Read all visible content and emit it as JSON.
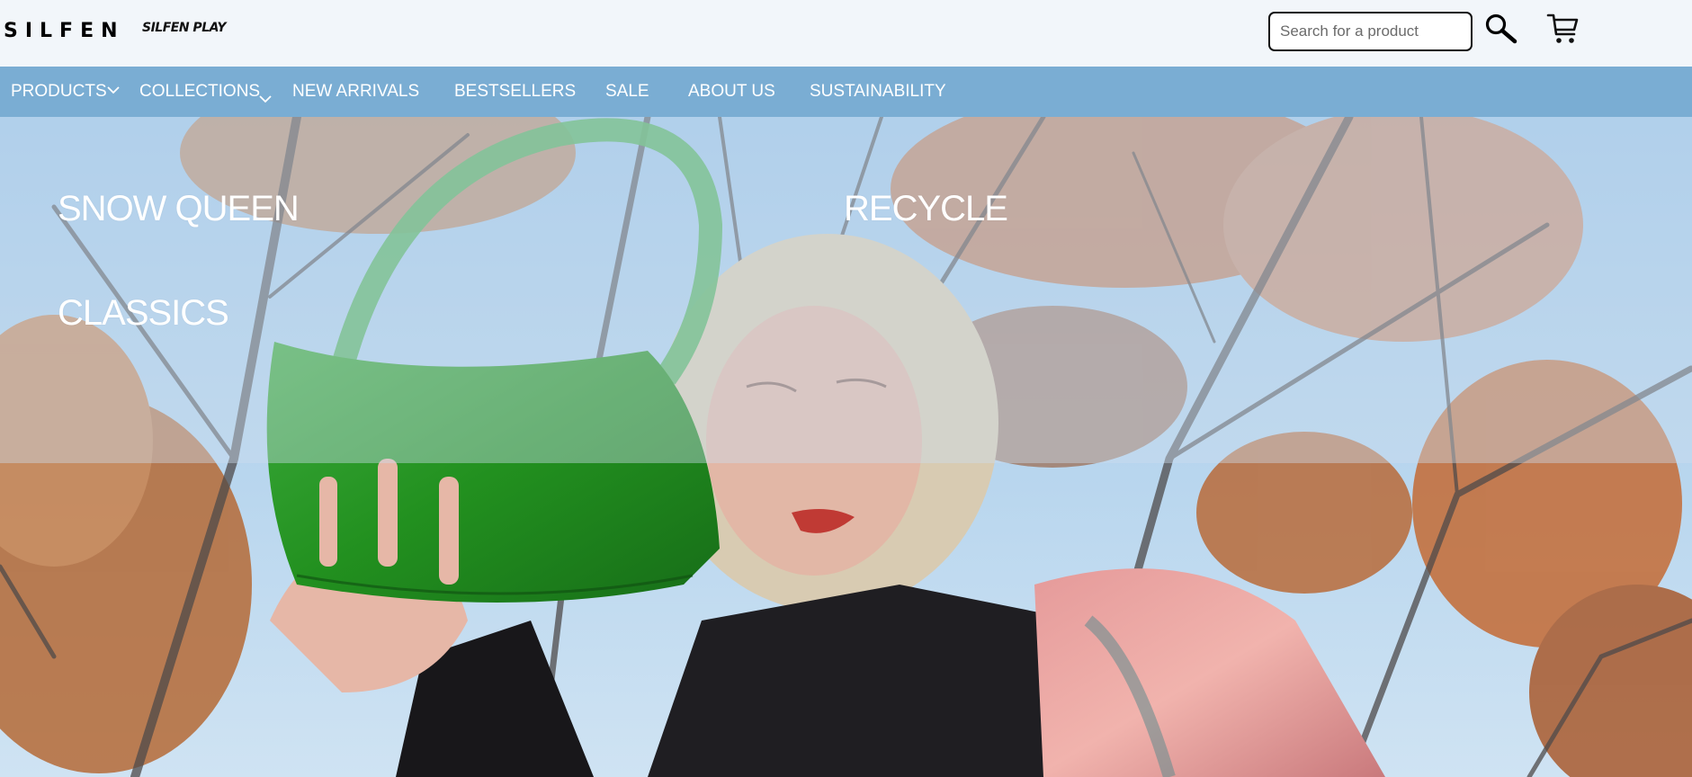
{
  "header": {
    "logo": "SILFEN",
    "sub_logo": "SILFEN PLAY",
    "search_placeholder": "Search for a product"
  },
  "nav": {
    "items": [
      {
        "label": "PRODUCTS",
        "has_dropdown": true
      },
      {
        "label": "COLLECTIONS",
        "has_dropdown": true
      },
      {
        "label": "NEW ARRIVALS"
      },
      {
        "label": "BESTSELLERS"
      },
      {
        "label": "SALE"
      },
      {
        "label": "ABOUT US"
      },
      {
        "label": "SUSTAINABILITY"
      }
    ]
  },
  "collections_menu": {
    "items": [
      "SNOW QUEEN",
      "RECYCLE",
      "CLASSICS"
    ]
  },
  "icons": {
    "search": "search-icon",
    "cart": "cart-icon",
    "dropdown": "chevron-down-icon"
  },
  "colors": {
    "nav_bar": "#7aadd3",
    "header_bg": "#f2f6fa",
    "nav_text": "#ffffff"
  }
}
